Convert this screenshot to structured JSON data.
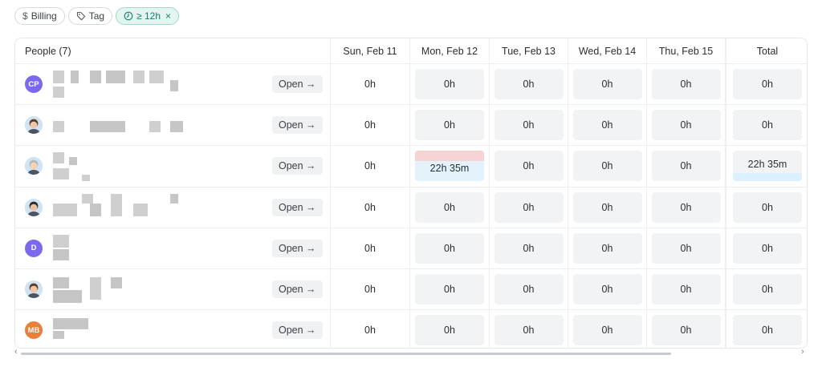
{
  "filters": [
    {
      "icon": "$",
      "icon_name": "dollar-icon",
      "label": "Billing",
      "active": false
    },
    {
      "icon": "⌑",
      "icon_name": "tag-icon",
      "label": "Tag",
      "active": false
    },
    {
      "icon": "◷",
      "icon_name": "clock-icon",
      "label": "≥ 12h",
      "active": true,
      "remove": "×"
    }
  ],
  "table": {
    "header": {
      "people": "People (7)",
      "days": [
        "Sun, Feb 11",
        "Mon, Feb 12",
        "Tue, Feb 13",
        "Wed, Feb 14",
        "Thu, Feb 15"
      ],
      "total": "Total"
    },
    "open_label": "Open →",
    "rows": [
      {
        "avatar": "CP",
        "avatar_type": "initials",
        "values": [
          "0h",
          "0h",
          "0h",
          "0h",
          "0h"
        ],
        "total": "0h"
      },
      {
        "avatar": "",
        "avatar_type": "photo",
        "values": [
          "0h",
          "0h",
          "0h",
          "0h",
          "0h"
        ],
        "total": "0h"
      },
      {
        "avatar": "",
        "avatar_type": "photo",
        "values": [
          "0h",
          "22h 35m",
          "0h",
          "0h",
          "0h"
        ],
        "total": "22h 35m",
        "highlight_day": 1
      },
      {
        "avatar": "",
        "avatar_type": "photo",
        "values": [
          "0h",
          "0h",
          "0h",
          "0h",
          "0h"
        ],
        "total": "0h"
      },
      {
        "avatar": "D",
        "avatar_type": "initials",
        "values": [
          "0h",
          "0h",
          "0h",
          "0h",
          "0h"
        ],
        "total": "0h"
      },
      {
        "avatar": "",
        "avatar_type": "photo",
        "values": [
          "0h",
          "0h",
          "0h",
          "0h",
          "0h"
        ],
        "total": "0h"
      },
      {
        "avatar": "MB",
        "avatar_type": "initials",
        "values": [
          "0h",
          "0h",
          "0h",
          "0h",
          "0h"
        ],
        "total": "0h"
      }
    ]
  },
  "colors": {
    "accent": "#7b68ee",
    "orange": "#e8803a",
    "filter_active": "#177e6b",
    "over_limit": "#f6d3d5"
  },
  "scroll": {
    "left_arrow": "‹",
    "right_arrow": "›"
  }
}
